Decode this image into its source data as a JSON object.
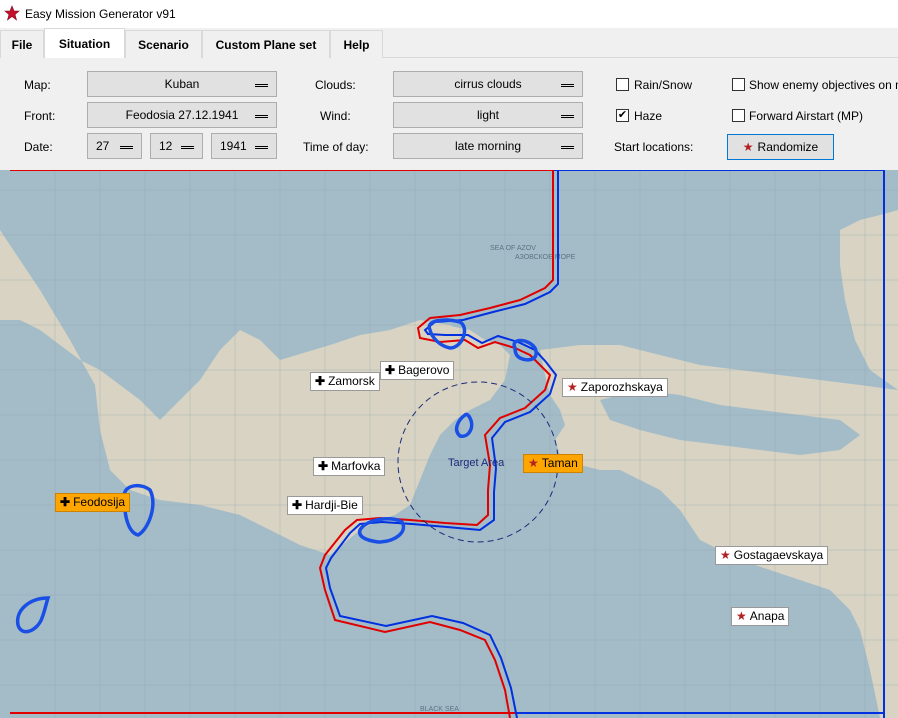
{
  "window": {
    "title": "Easy Mission Generator v91"
  },
  "tabs": [
    {
      "label": "File"
    },
    {
      "label": "Situation"
    },
    {
      "label": "Scenario"
    },
    {
      "label": "Custom Plane set"
    },
    {
      "label": "Help"
    }
  ],
  "form": {
    "map_label": "Map:",
    "map_value": "Kuban",
    "front_label": "Front:",
    "front_value": "Feodosia 27.12.1941",
    "date_label": "Date:",
    "date_day": "27",
    "date_month": "12",
    "date_year": "1941",
    "clouds_label": "Clouds:",
    "clouds_value": "cirrus clouds",
    "wind_label": "Wind:",
    "wind_value": "light",
    "time_label": "Time of day:",
    "time_value": "late morning",
    "rain_label": "Rain/Snow",
    "rain_checked": false,
    "haze_label": "Haze",
    "haze_checked": true,
    "show_enemy_label": "Show enemy objectives on map",
    "show_enemy_checked": false,
    "forward_airstart_label": "Forward Airstart (MP)",
    "forward_airstart_checked": false,
    "start_locations_label": "Start locations:",
    "randomize_label": "Randomize"
  },
  "map": {
    "sea_label_top": "SEA OF AZOV",
    "sea_label_top_ru": "АЗОВСКОЕ МОРЕ",
    "sea_label_bottom": "BLACK SEA",
    "target_label": "Target Area",
    "colors": {
      "sea": "#9fb9c6",
      "land": "#d9d4c4",
      "red_front": "#e00000",
      "blue_front": "#0030e0",
      "highlight": "#ffa500"
    },
    "airfields_allied": [
      {
        "name": "Zamorsk"
      },
      {
        "name": "Bagerovo"
      },
      {
        "name": "Marfovka"
      },
      {
        "name": "Hardji-Bie"
      },
      {
        "name": "Feodosija"
      }
    ],
    "airfields_enemy": [
      {
        "name": "Zaporozhskaya"
      },
      {
        "name": "Taman"
      },
      {
        "name": "Gostagaevskaya"
      },
      {
        "name": "Anapa"
      }
    ]
  }
}
